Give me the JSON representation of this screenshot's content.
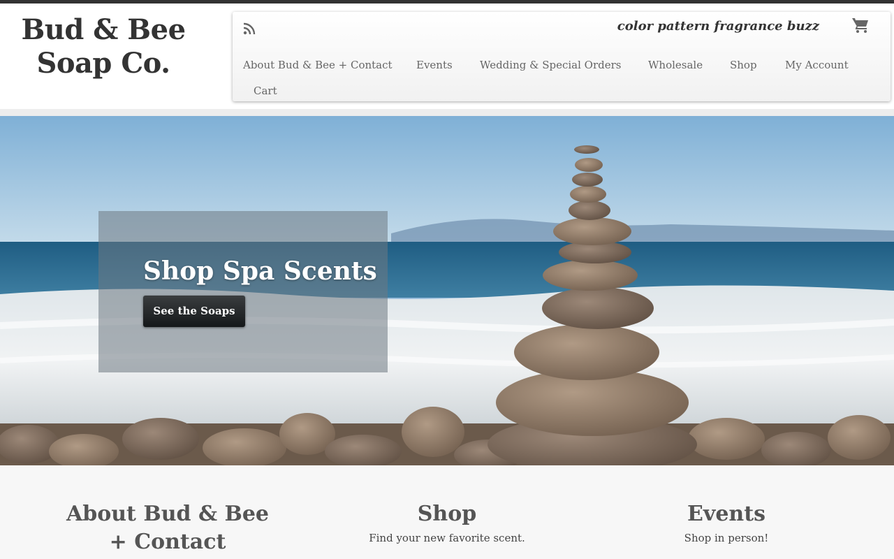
{
  "site": {
    "logo_line1": "Bud & Bee",
    "logo_line2": "Soap Co.",
    "tagline": "color pattern fragrance buzz"
  },
  "nav": {
    "items": [
      {
        "label": "About Bud & Bee + Contact"
      },
      {
        "label": "Events"
      },
      {
        "label": "Wedding & Special Orders"
      },
      {
        "label": "Wholesale"
      },
      {
        "label": "Shop"
      },
      {
        "label": "My Account"
      },
      {
        "label": "Cart"
      }
    ],
    "rss_icon": "rss-icon",
    "cart_icon": "shopping-cart-icon"
  },
  "hero": {
    "title": "Shop Spa Scents",
    "button_label": "See the Soaps"
  },
  "features": [
    {
      "title": "About Bud & Bee + Contact",
      "text": ""
    },
    {
      "title": "Shop",
      "text": "Find your new favorite scent."
    },
    {
      "title": "Events",
      "text": "Shop in person!"
    }
  ],
  "colors": {
    "text_dark": "#333333",
    "nav_text": "#666666",
    "button_bg": "#1f2224",
    "features_bg": "#f7f7f7"
  }
}
